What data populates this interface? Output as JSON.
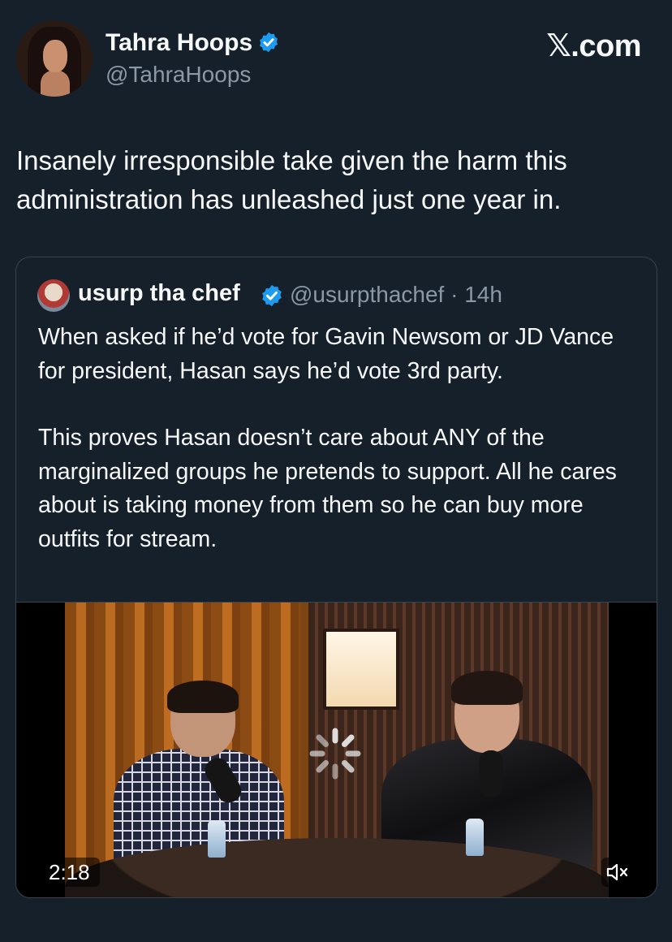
{
  "tweet": {
    "author_name": "Tahra Hoops",
    "author_handle": "@TahraHoops",
    "brand": "𝕏.com",
    "text": "Insanely irresponsible take given the harm this administration has unleashed just one year in."
  },
  "quote": {
    "author_name": "usurp tha chef",
    "author_handle": "@usurpthachef",
    "separator": "·",
    "time": "14h",
    "paragraphs": [
      "When asked if he’d vote for Gavin Newsom or JD Vance for president, Hasan says he’d vote 3rd party.",
      "This proves Hasan doesn’t care about ANY of the marginalized groups he pretends to support. All he cares about is taking money from them so he can buy more outfits for stream."
    ],
    "video": {
      "duration": "2:18",
      "muted": true,
      "loading": true
    }
  },
  "colors": {
    "background": "#15202b",
    "text": "#f7f9f9",
    "secondary_text": "#8b98a5",
    "verified_blue": "#1d9bf0",
    "card_border": "#38444d"
  },
  "icons": [
    "verified-badge-icon",
    "loading-spinner-icon",
    "muted-speaker-icon"
  ]
}
